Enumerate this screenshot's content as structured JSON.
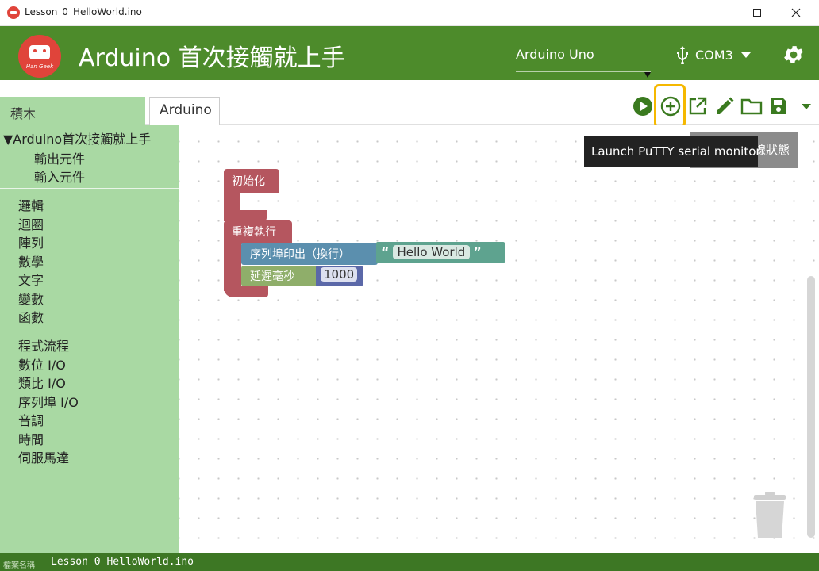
{
  "window": {
    "title": "Lesson_0_HelloWorld.ino",
    "minimize_icon": "minimize-icon",
    "maximize_icon": "maximize-icon",
    "close_icon": "close-icon"
  },
  "header": {
    "logo_text": "Han Geek",
    "title": "Arduino 首次接觸就上手",
    "board": "Arduino Uno",
    "port": "COM3",
    "accent": "#4d8b2b",
    "settings_icon": "gear-icon"
  },
  "tabs": {
    "blocks": "積木",
    "arduino": "Arduino"
  },
  "toolbar": {
    "icons": [
      "run-icon",
      "add-circle-icon",
      "open-external-icon",
      "edit-icon",
      "folder-icon",
      "save-icon",
      "more-caret-icon"
    ],
    "tooltip": "Launch PuTTY serial monitor",
    "tooltip_behind": "線狀態"
  },
  "sidebar": {
    "root": "▼Arduino首次接觸就上手",
    "sub_items": [
      "輸出元件",
      "輸入元件"
    ],
    "group1": [
      "邏輯",
      "迴圈",
      "陣列",
      "數學",
      "文字",
      "變數",
      "函數"
    ],
    "group2": [
      "程式流程",
      "數位 I/O",
      "類比 I/O",
      "序列埠 I/O",
      "音調",
      "時間",
      "伺服馬達"
    ]
  },
  "blocks": {
    "setup": "初始化",
    "loop": "重複執行",
    "print": "序列埠印出（換行）",
    "string_open": "“",
    "string_value": "Hello World",
    "string_close": "”",
    "delay": "延遲毫秒",
    "delay_value": "1000"
  },
  "status": {
    "label": "檔案名稱",
    "file": "Lesson 0 HelloWorld.ino"
  }
}
